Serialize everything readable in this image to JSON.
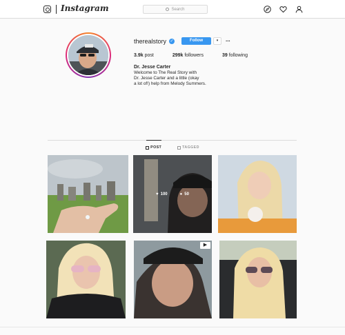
{
  "topbar": {
    "brand": "Instagram",
    "search_placeholder": "Search",
    "icons": [
      "instagram-glyph",
      "compass-icon",
      "heart-icon",
      "person-icon"
    ]
  },
  "profile": {
    "username": "therealstory",
    "verified": true,
    "follow_label": "Follow",
    "dropdown_glyph": "▾",
    "more_glyph": "···",
    "stats": [
      {
        "value": "3.9k",
        "label": "post"
      },
      {
        "value": "299k",
        "label": "followers"
      },
      {
        "value": "39",
        "label": "following"
      }
    ],
    "full_name": "Dr. Jesse Carter",
    "bio": [
      "Welcome to The Real Story with",
      "Dr. Jesse Carter and a little (okay",
      "a lot of!) help from Melody Summers."
    ]
  },
  "tabs": [
    {
      "label": "POST",
      "active": true
    },
    {
      "label": "TAGGED",
      "active": false
    }
  ],
  "grid": {
    "hover_overlay": {
      "likes": "100",
      "comments": "50"
    },
    "posts": [
      {
        "subject": "stonehenge-ring-hand"
      },
      {
        "subject": "man-cap-pawn-sign-hovered"
      },
      {
        "subject": "blonde-woman-with-dog"
      },
      {
        "subject": "blonde-woman-heart-sunglasses"
      },
      {
        "subject": "man-cap-selfie-video"
      },
      {
        "subject": "blonde-woman-car-sunglasses"
      }
    ]
  },
  "colors": {
    "accent_blue": "#3897f0",
    "border": "#dbdbdb",
    "background": "#fafafa",
    "text": "#262626"
  }
}
